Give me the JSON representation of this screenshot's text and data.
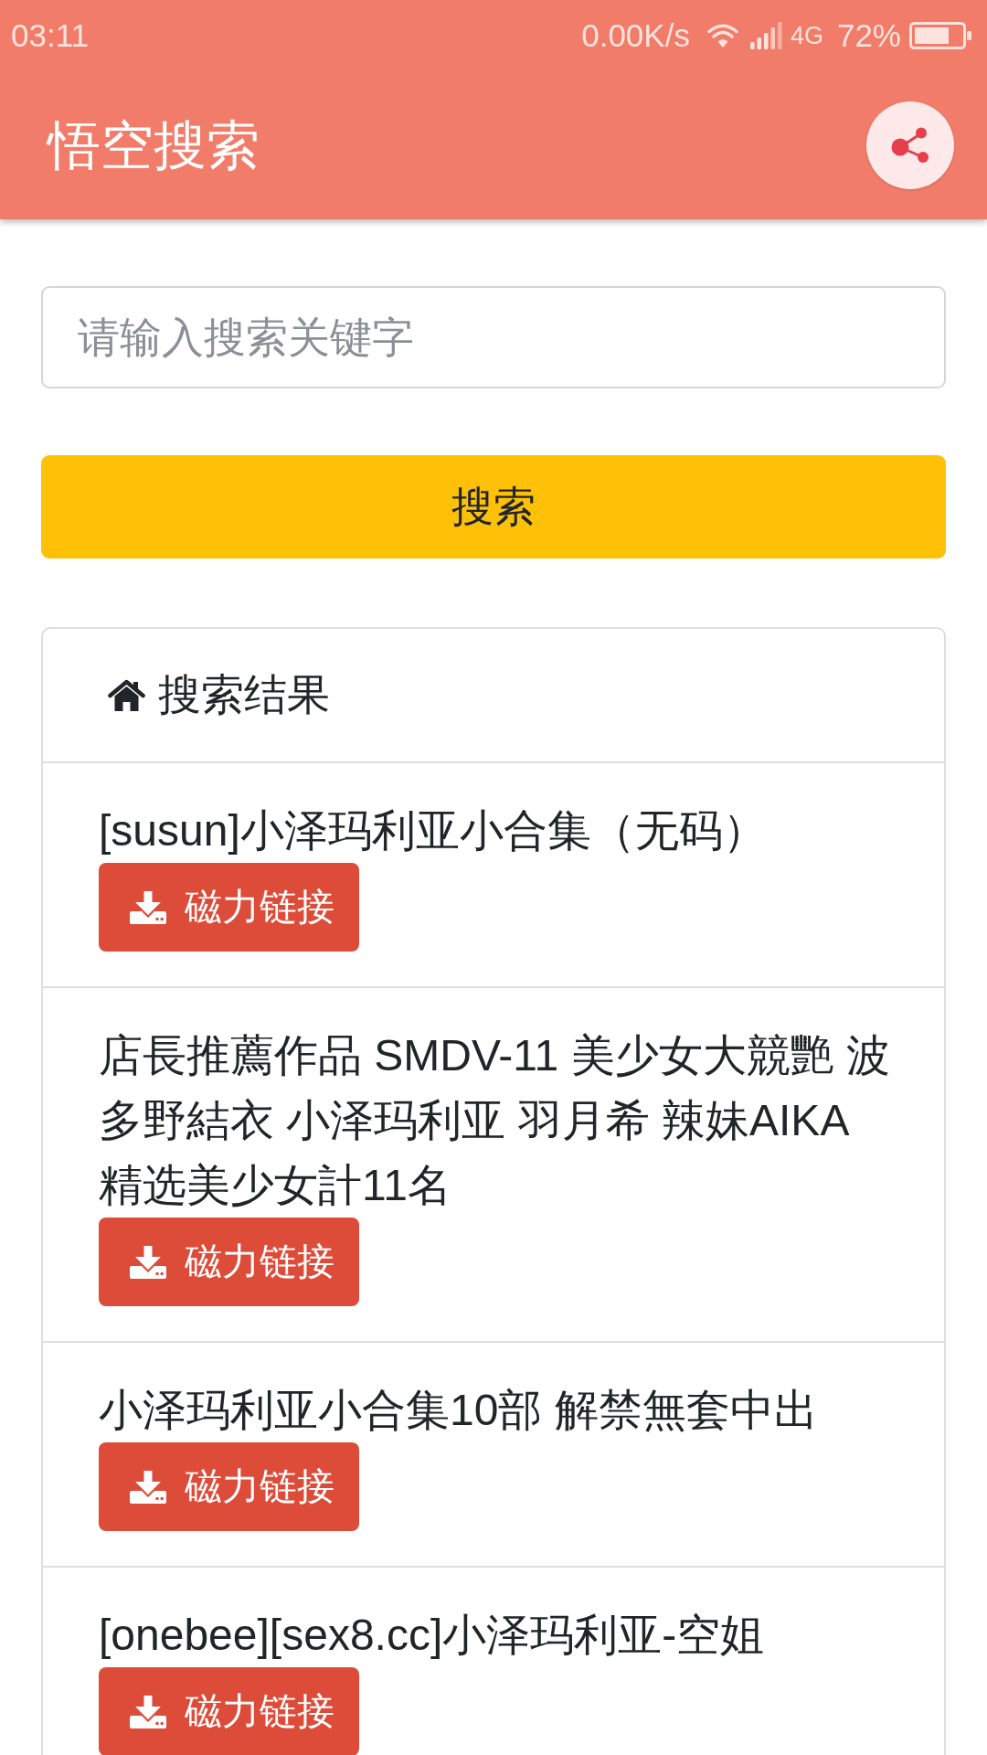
{
  "status_bar": {
    "time": "03:11",
    "network_speed": "0.00K/s",
    "network_type": "4G",
    "battery": "72%"
  },
  "app_bar": {
    "title": "悟空搜索"
  },
  "search": {
    "placeholder": "请输入搜索关键字",
    "button": "搜索"
  },
  "results": {
    "title": "搜索结果",
    "items": [
      {
        "title": "[susun]小泽玛利亚小合集（无码）",
        "button": "磁力链接"
      },
      {
        "title": "店長推薦作品 SMDV-11 美少女大競艷 波多野結衣 小泽玛利亚 羽月希 辣妹AIKA 精选美少女計11名",
        "button": "磁力链接"
      },
      {
        "title": "小泽玛利亚小合集10部 解禁無套中出",
        "button": "磁力链接"
      },
      {
        "title": "[onebee][sex8.cc]小泽玛利亚-空姐",
        "button": "磁力链接"
      }
    ]
  }
}
